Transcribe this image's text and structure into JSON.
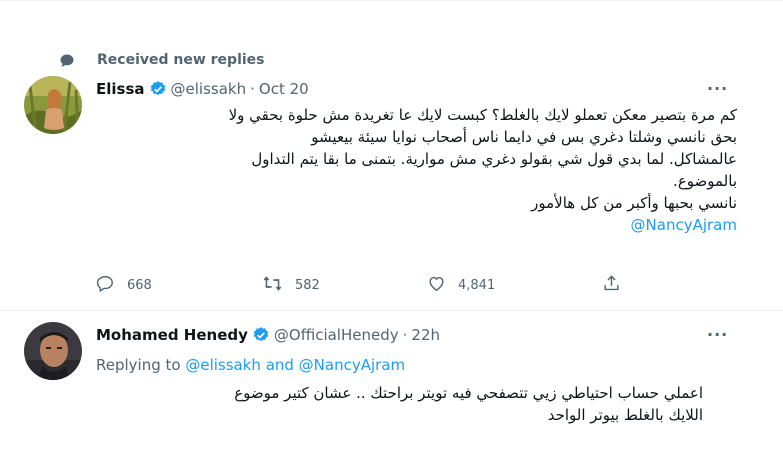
{
  "notice": {
    "text": "Received new replies"
  },
  "tweet1": {
    "name": "Elissa",
    "handle": "@elissakh",
    "dot": "·",
    "time": "Oct 20",
    "more": "···",
    "lines": [
      "كم مرة بتصير معكن تعملو لايك بالغلط؟ كبست لايك عا تغريدة مش حلوة بحقي ولا",
      "بحق نانسي وشلتا دغري بس في دايما ناس أصحاب نوايا سيئة بيعيشو",
      "عالمشاكل. لما بدي قول شي بقولو دغري مش موارية. بتمنى ما بقا يتم التداول",
      "بالموضوع.",
      "نانسي بحبها وأكبر من كل هالأمور"
    ],
    "mention": "@NancyAjram",
    "stats": {
      "replies": "668",
      "retweets": "582",
      "likes": "4,841"
    }
  },
  "tweet2": {
    "name": "Mohamed Henedy",
    "handle": "@OfficialHenedy",
    "dot": "·",
    "time": "22h",
    "more": "···",
    "replying_prefix": "Replying to ",
    "replying_to": "@elissakh and @NancyAjram",
    "lines": [
      "اعملي حساب احتياطي زيي تتصفحي فيه تويتر براحتك .. عشان كتير موضوع",
      "اللايك بالغلط بيوتر الواحد"
    ]
  },
  "colors": {
    "accent": "#1d9bf0",
    "muted": "#536471",
    "text": "#0f1419",
    "divider": "#eff3f4"
  },
  "icons": [
    "chat-bubble-icon",
    "verified-badge-icon",
    "reply-icon",
    "retweet-icon",
    "like-icon",
    "share-icon",
    "more-icon"
  ]
}
